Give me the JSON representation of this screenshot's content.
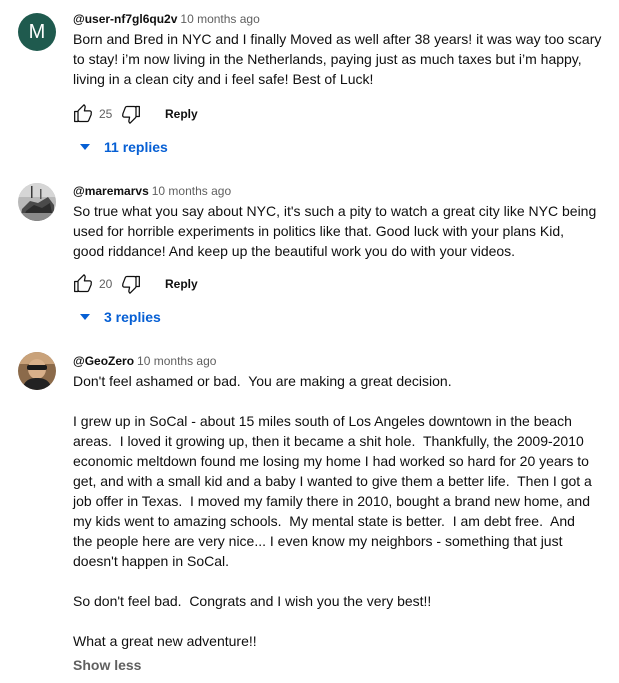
{
  "comments": [
    {
      "avatar_letter": "M",
      "author": "@user-nf7gl6qu2v",
      "time": "10 months ago",
      "text": "Born and Bred in NYC and I finally Moved as well after 38 years! it was way too scary\nto stay! i’m now living in the Netherlands, paying just as much taxes but i’m happy,\nliving in a clean city and i feel safe! Best of Luck!",
      "likes": "25",
      "reply_label": "Reply",
      "replies_label": "11 replies"
    },
    {
      "author": "@maremarvs",
      "time": "10 months ago",
      "text": "So true what you say about NYC, it's such a pity to watch a great city like NYC being\nused for horrible experiments in politics like that. Good luck with your plans Kid,\ngood riddance! And keep up the beautiful work you do with your videos.",
      "likes": "20",
      "reply_label": "Reply",
      "replies_label": "3 replies"
    },
    {
      "author": "@GeoZero",
      "time": "10 months ago",
      "text": "Don't feel ashamed or bad.  You are making a great decision.\n\nI grew up in SoCal - about 15 miles south of Los Angeles downtown in the beach\nareas.  I loved it growing up, then it became a shit hole.  Thankfully, the 2009-2010\neconomic meltdown found me losing my home I had worked so hard for 20 years to\nget, and with a small kid and a baby I wanted to give them a better life.  Then I got a\njob offer in Texas.  I moved my family there in 2010, bought a brand new home, and\nmy kids went to amazing schools.  My mental state is better.  I am debt free.  And\nthe people here are very nice... I even know my neighbors - something that just\ndoesn't happen in SoCal.\n\nSo don't feel bad.  Congrats and I wish you the very best!!\n\nWhat a great new adventure!!",
      "show_less_label": "Show less"
    }
  ],
  "colors": {
    "link_blue": "#065fd4",
    "secondary_text": "#606060",
    "avatar_m_bg": "#1f5a4e"
  },
  "icons": {
    "like": "thumb-up-icon",
    "dislike": "thumb-down-icon",
    "expand": "caret-down-icon"
  }
}
